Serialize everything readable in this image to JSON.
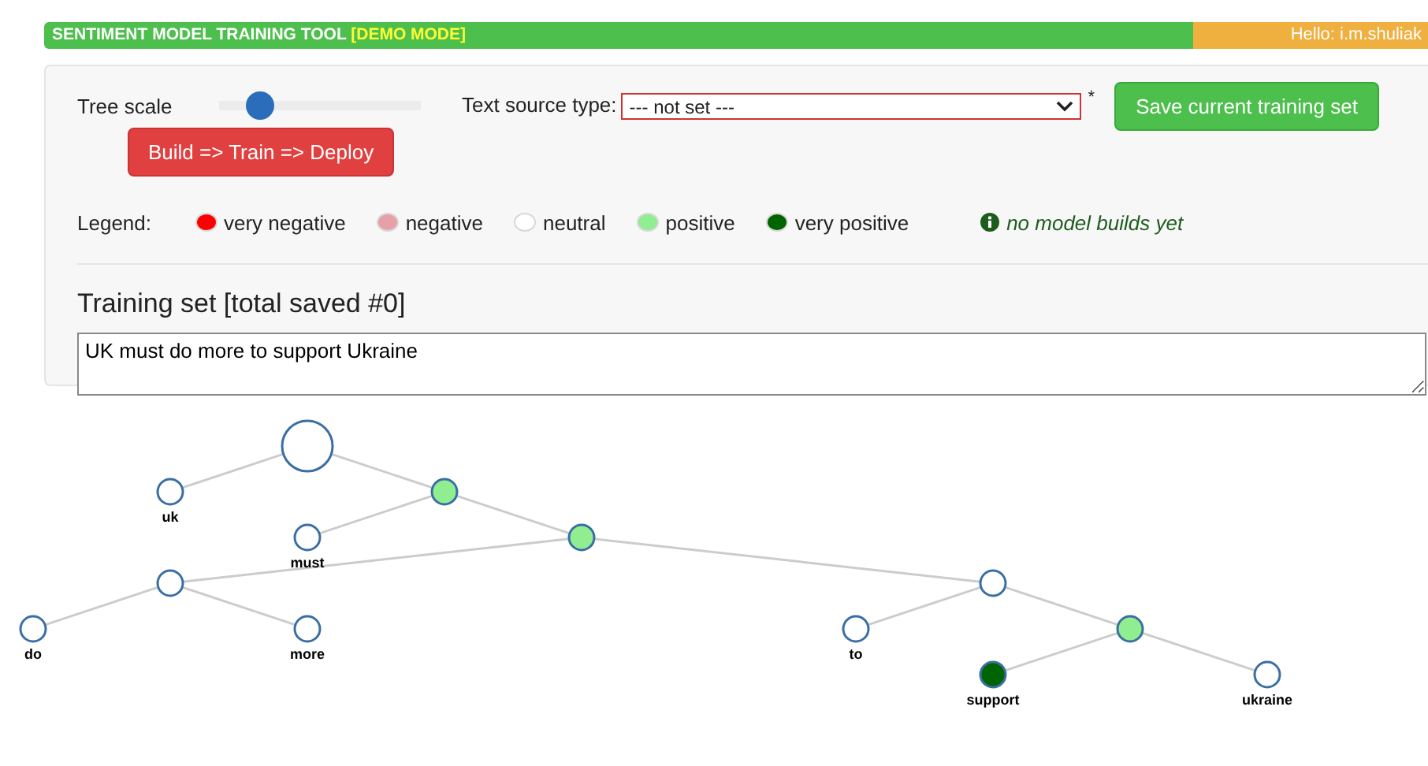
{
  "header": {
    "title": "SENTIMENT MODEL TRAINING TOOL",
    "mode": "[DEMO MODE]",
    "greeting": "Hello: i.m.shuliak"
  },
  "controls": {
    "tree_scale_label": "Tree scale",
    "tree_scale": {
      "level": 0.2
    },
    "build_button": "Build => Train => Deploy",
    "source_label": "Text source type:",
    "source_value": "--- not set ---",
    "required_mark": "*",
    "save_button": "Save current training set"
  },
  "legend": {
    "label": "Legend:",
    "items": [
      {
        "label": "very negative",
        "color": "#ff0000"
      },
      {
        "label": "negative",
        "color": "#e8a0a8"
      },
      {
        "label": "neutral",
        "color": "#ffffff"
      },
      {
        "label": "positive",
        "color": "#90ee90"
      },
      {
        "label": "very positive",
        "color": "#006400"
      }
    ],
    "status": "no model builds yet"
  },
  "training_set": {
    "title": "Training set [total saved #0]",
    "text": "UK must do more to support Ukraine"
  },
  "tree": {
    "color": "#ffffff",
    "children": [
      {
        "label": "uk",
        "color": "#ffffff"
      },
      {
        "color": "#90ee90",
        "children": [
          {
            "label": "must",
            "color": "#ffffff"
          },
          {
            "color": "#90ee90",
            "children": [
              {
                "color": "#ffffff",
                "children": [
                  {
                    "label": "do",
                    "color": "#ffffff"
                  },
                  {
                    "label": "more",
                    "color": "#ffffff"
                  }
                ]
              },
              {
                "color": "#ffffff",
                "children": [
                  {
                    "label": "to",
                    "color": "#ffffff"
                  },
                  {
                    "color": "#90ee90",
                    "children": [
                      {
                        "label": "support",
                        "color": "#006400"
                      },
                      {
                        "label": "ukraine",
                        "color": "#ffffff"
                      }
                    ]
                  }
                ]
              }
            ]
          }
        ]
      }
    ]
  }
}
